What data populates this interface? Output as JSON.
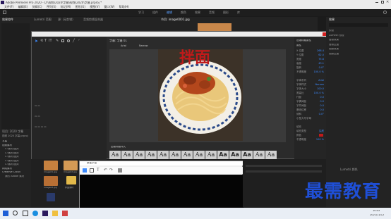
{
  "app": {
    "title": "Adobe Premiere Pro 2020 - D:\\视频\\2020\\字幕\\视频\\2020\\字幕.prproj *",
    "menu": [
      "文件(F)",
      "编辑(E)",
      "剪辑(C)",
      "序列(S)",
      "标记(M)",
      "图形(G)",
      "视图(V)",
      "窗口(W)",
      "帮助(H)"
    ],
    "workspaces": [
      "学习",
      "组件",
      "编辑",
      "颜色",
      "效果",
      "音频",
      "图形",
      "库"
    ],
    "active_workspace": "编辑"
  },
  "left_panel": {
    "tabs": [
      "效果控件",
      "Lumetri 范围",
      "源: (无剪辑)",
      "音频剪辑混合器"
    ],
    "project_title": "项目: 2020 字幕",
    "project_file": "视频 2020 字幕.prproj",
    "tree": [
      "字幕",
      "视频素材",
      "C:\\素材\\图片",
      "C:\\素材\\图片",
      "C:\\素材\\图片",
      "C:\\素材\\图片",
      "C:\\素材\\图片",
      "网络素材",
      "Creative Cloud",
      "我的 Adobe 素材"
    ],
    "media_labels": [
      "image01.jpg",
      "image02.jpg",
      "image03.jpg",
      "拌面素材"
    ]
  },
  "program_panel": {
    "tab": "节目: image0001.jpg",
    "right_tab": "拌面"
  },
  "titler": {
    "header": "字幕: 字幕 01",
    "font_name": "Arial",
    "font_style": "Narrow",
    "caption": "拌面",
    "styles_header": "旧版标题样式",
    "style_tiles": [
      "Aa",
      "Aa",
      "Aa",
      "Aa",
      "Aa",
      "Aa",
      "Aa",
      "Aa",
      "Aa",
      "Aa",
      "Aa",
      "Aa",
      "Aa",
      "Aa",
      "Aa"
    ]
  },
  "properties": {
    "header": "旧版标题属性",
    "section": "属性",
    "rows": [
      {
        "label": "X 位置",
        "value": "268.4"
      },
      {
        "label": "Y 位置",
        "value": "62.0"
      },
      {
        "label": "宽度",
        "value": "75.6"
      },
      {
        "label": "高度",
        "value": "43.1"
      },
      {
        "label": "旋转",
        "value": "0.0°"
      },
      {
        "label": "不透明度",
        "value": "100.0 %"
      },
      {
        "label": "字体系列",
        "value": "Arial"
      },
      {
        "label": "字体样式",
        "value": "Narrow"
      },
      {
        "label": "字体大小",
        "value": "100.0"
      },
      {
        "label": "宽高比",
        "value": "100.0 %"
      },
      {
        "label": "行距",
        "value": "0.0"
      },
      {
        "label": "字偶间距",
        "value": "0.0"
      },
      {
        "label": "字符间距",
        "value": "0.0"
      },
      {
        "label": "基线位移",
        "value": "0.0"
      },
      {
        "label": "倾斜",
        "value": "0.0°"
      },
      {
        "label": "小型大写字母",
        "value": ""
      },
      {
        "label": "填充",
        "value": ""
      },
      {
        "label": "填充类型",
        "value": "实底"
      },
      {
        "label": "颜色",
        "value": ""
      },
      {
        "label": "不透明度",
        "value": "100 %"
      }
    ]
  },
  "right_panel": {
    "tab": "效果",
    "items": [
      "预设",
      "Lumetri 预设",
      "音频效果",
      "音频过渡",
      "视频效果",
      "视频过渡"
    ],
    "lower_tab": "Lumetri 颜色"
  },
  "popup": {
    "title": "新建字幕",
    "watermark": "最需教育"
  },
  "taskbar": {
    "time": "10:43",
    "date": "2021/11/12"
  },
  "colors": {
    "accent_blue": "#3d8bff",
    "caption_red": "#c01a1a",
    "watermark_blue": "#1f4fd6"
  }
}
